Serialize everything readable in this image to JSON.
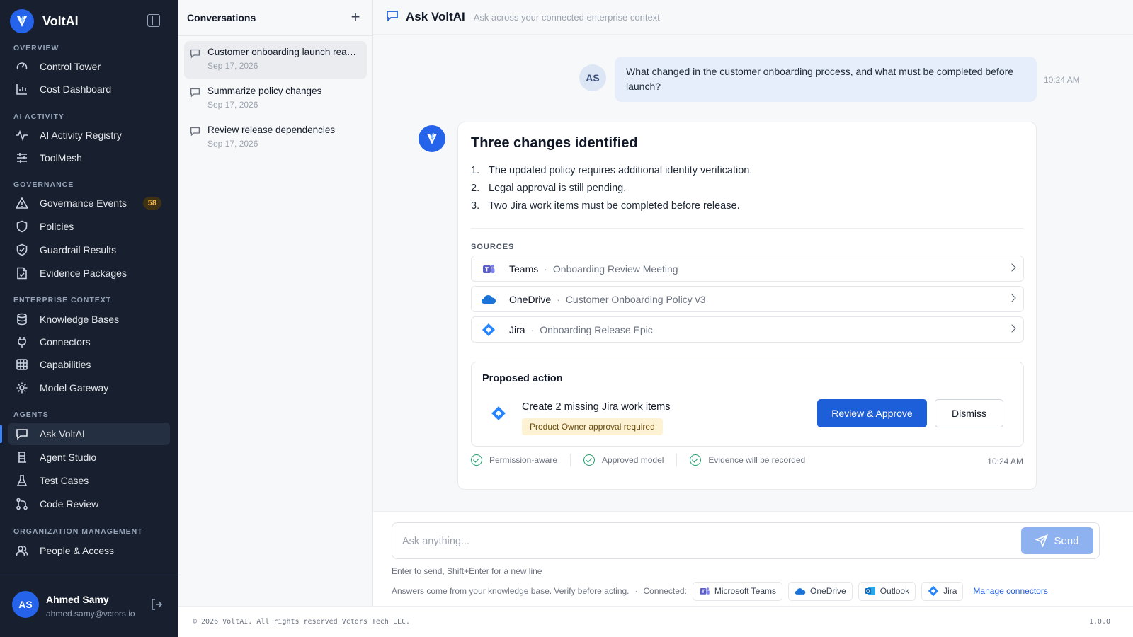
{
  "brand": {
    "name": "VoltAI"
  },
  "sidebar": {
    "sections": {
      "overview": "OVERVIEW",
      "ai_activity": "AI ACTIVITY",
      "governance": "GOVERNANCE",
      "enterprise": "ENTERPRISE CONTEXT",
      "agents": "AGENTS",
      "org": "ORGANIZATION MANAGEMENT"
    },
    "items": {
      "control_tower": "Control Tower",
      "cost_dashboard": "Cost Dashboard",
      "ai_activity_registry": "AI Activity Registry",
      "toolmesh": "ToolMesh",
      "governance_events": "Governance Events",
      "governance_events_badge": "58",
      "policies": "Policies",
      "guardrail_results": "Guardrail Results",
      "evidence_packages": "Evidence Packages",
      "knowledge_bases": "Knowledge Bases",
      "connectors": "Connectors",
      "capabilities": "Capabilities",
      "model_gateway": "Model Gateway",
      "ask_voltai": "Ask VoltAI",
      "agent_studio": "Agent Studio",
      "test_cases": "Test Cases",
      "code_review": "Code Review",
      "people_access": "People & Access"
    },
    "user": {
      "initials": "AS",
      "name": "Ahmed Samy",
      "email": "ahmed.samy@vctors.io"
    }
  },
  "conversations": {
    "title": "Conversations",
    "items": [
      {
        "title": "Customer onboarding launch read...",
        "date": "Sep 17, 2026"
      },
      {
        "title": "Summarize policy changes",
        "date": "Sep 17, 2026"
      },
      {
        "title": "Review release dependencies",
        "date": "Sep 17, 2026"
      }
    ]
  },
  "main": {
    "title": "Ask VoltAI",
    "subtitle": "Ask across your connected enterprise context",
    "user_message": {
      "initials": "AS",
      "text": "What changed in the customer onboarding process, and what must be completed before launch?",
      "time": "10:24 AM"
    },
    "answer": {
      "title": "Three changes identified",
      "points": [
        {
          "n": "1.",
          "text": "The updated policy requires additional identity verification."
        },
        {
          "n": "2.",
          "text": "Legal approval is still pending."
        },
        {
          "n": "3.",
          "text": "Two Jira work items must be completed before release."
        }
      ],
      "sources_label": "SOURCES",
      "sources": [
        {
          "name": "Teams",
          "sep": "·",
          "desc": "Onboarding Review Meeting",
          "icon": "teams-icon"
        },
        {
          "name": "OneDrive",
          "sep": "·",
          "desc": "Customer Onboarding Policy v3",
          "icon": "onedrive-icon"
        },
        {
          "name": "Jira",
          "sep": "·",
          "desc": "Onboarding Release Epic",
          "icon": "jira-icon"
        }
      ],
      "proposed": {
        "title": "Proposed action",
        "action": "Create 2 missing Jira work items",
        "tag": "Product Owner approval required",
        "approve": "Review & Approve",
        "dismiss": "Dismiss"
      },
      "checks": [
        "Permission-aware",
        "Approved model",
        "Evidence will be recorded"
      ],
      "time": "10:24 AM"
    }
  },
  "composer": {
    "placeholder": "Ask anything...",
    "send": "Send",
    "hint": "Enter to send, Shift+Enter for a new line",
    "disclaimer": "Answers come from your knowledge base. Verify before acting.",
    "dot": "·",
    "connected_label": "Connected:",
    "connectors": [
      "Microsoft Teams",
      "OneDrive",
      "Outlook",
      "Jira"
    ],
    "manage": "Manage connectors"
  },
  "footer": {
    "copyright": "© 2026 VoltAI. All rights reserved Vctors Tech LLC.",
    "version": "1.0.0"
  },
  "colors": {
    "accent": "#1d5fd9",
    "sidebar": "#18202f",
    "badge": "#f0b54a",
    "success": "#22a06b"
  }
}
